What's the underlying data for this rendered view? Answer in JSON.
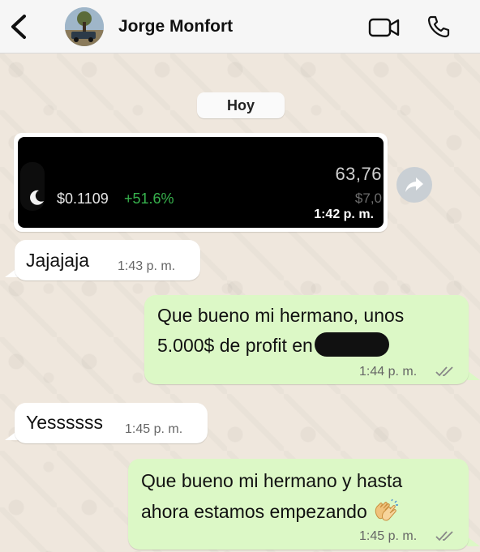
{
  "header": {
    "contact_name": "Jorge Monfort",
    "icons": [
      "back-icon",
      "avatar",
      "video-call-icon",
      "phone-icon"
    ]
  },
  "chat": {
    "date_label": "Hoy",
    "image_message": {
      "price": "$0.1109",
      "change": "+51.6%",
      "value": "63,76",
      "sub_value": "$7,0",
      "time": "1:42 p. m."
    },
    "messages": [
      {
        "direction": "in",
        "text": "Jajajaja",
        "time": "1:43 p. m."
      },
      {
        "direction": "out",
        "line1": "Que bueno mi hermano, unos",
        "line2": "5.000$ de profit en",
        "time": "1:44 p. m.",
        "status": "read"
      },
      {
        "direction": "in",
        "text": "Yessssss",
        "time": "1:45 p. m."
      },
      {
        "direction": "out",
        "line1": "Que bueno mi hermano y hasta",
        "line2": "ahora estamos empezando",
        "time": "1:45 p. m.",
        "status": "read"
      }
    ]
  },
  "colors": {
    "outgoing_bubble": "#dcf8c6",
    "incoming_bubble": "#ffffff",
    "wallpaper": "#efe7dd",
    "positive_change": "#37b24d"
  }
}
